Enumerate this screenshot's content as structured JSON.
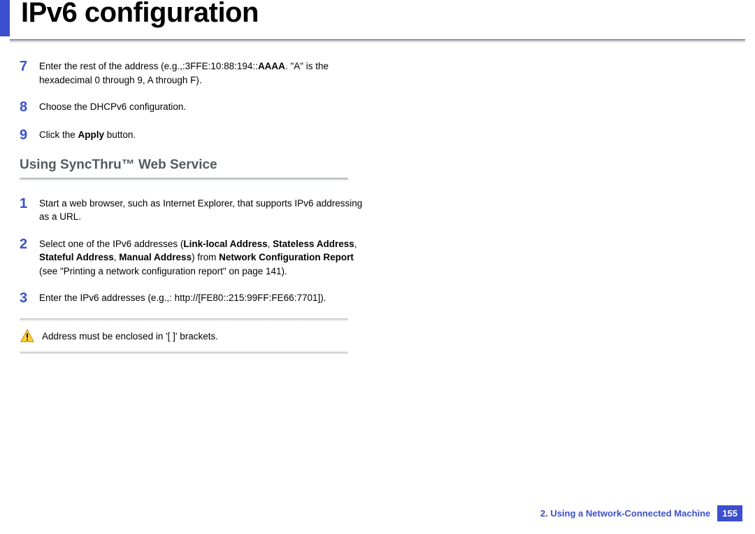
{
  "page_title": "IPv6 configuration",
  "steps_a": [
    {
      "n": "7",
      "before": "Enter the rest of the address (e.g.,:3FFE:10:88:194::",
      "bold": "AAAA",
      "after": ". \"A\" is the hexadecimal 0 through 9, A through F)."
    },
    {
      "n": "8",
      "before": "Choose the DHCPv6 configuration.",
      "bold": "",
      "after": ""
    },
    {
      "n": "9",
      "before": "Click the ",
      "bold": "Apply",
      "after": " button."
    }
  ],
  "section_title": "Using SyncThru™ Web Service",
  "steps_b": [
    {
      "n": "1",
      "before": "Start a web browser, such as Internet Explorer, that supports IPv6 addressing as a URL.",
      "bold": "",
      "after": ""
    },
    {
      "n": "2",
      "before": "Select one of the IPv6 addresses (",
      "bold": "Link-local Address",
      "after": ", ",
      "bold2": "Stateless Address",
      "after2": ", ",
      "bold3": "Stateful Address",
      "after3": ", ",
      "bold4": "Manual Address",
      "after4": ") from ",
      "bold5": "Network Configuration Report",
      "after5": " (see \"Printing a network configuration report\" on page 141)."
    },
    {
      "n": "3",
      "before": "Enter the IPv6 addresses (e.g.,: http://[FE80::215:99FF:FE66:7701]).",
      "bold": "",
      "after": ""
    }
  ],
  "warning_text": "Address must be enclosed in '[ ]' brackets.",
  "footer_chapter": "2.  Using a Network-Connected Machine",
  "footer_page": "155"
}
